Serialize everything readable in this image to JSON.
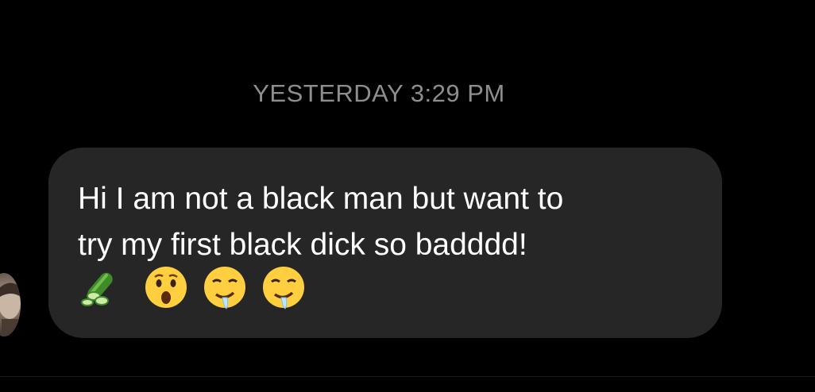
{
  "thread": {
    "timestamp": "YESTERDAY 3:29 PM"
  },
  "message": {
    "text": "Hi I am not a black man but want to\ntry my first black dick so badddd!",
    "emojis": [
      "cucumber-icon",
      "hushed-face-icon",
      "drooling-face-icon",
      "drooling-face-icon"
    ]
  },
  "colors": {
    "background": "#000000",
    "bubble": "#262626",
    "timestamp": "#8e8e8e",
    "text": "#ffffff"
  }
}
